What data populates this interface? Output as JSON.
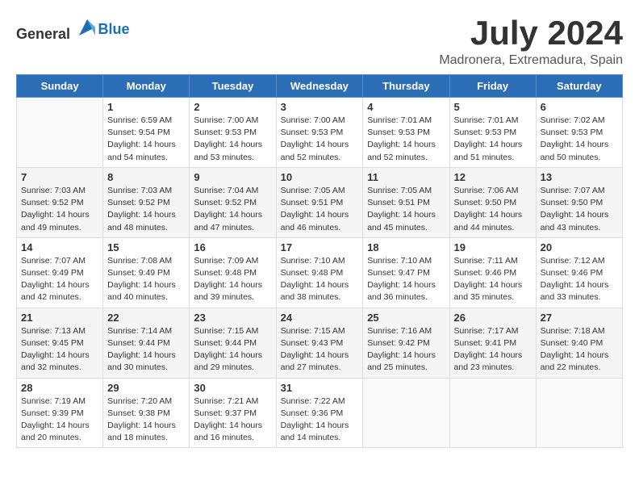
{
  "header": {
    "logo_general": "General",
    "logo_blue": "Blue",
    "month_title": "July 2024",
    "location": "Madronera, Extremadura, Spain"
  },
  "days_of_week": [
    "Sunday",
    "Monday",
    "Tuesday",
    "Wednesday",
    "Thursday",
    "Friday",
    "Saturday"
  ],
  "weeks": [
    [
      {
        "day": "",
        "empty": true
      },
      {
        "day": "1",
        "sunrise": "6:59 AM",
        "sunset": "9:54 PM",
        "daylight": "14 hours and 54 minutes."
      },
      {
        "day": "2",
        "sunrise": "7:00 AM",
        "sunset": "9:53 PM",
        "daylight": "14 hours and 53 minutes."
      },
      {
        "day": "3",
        "sunrise": "7:00 AM",
        "sunset": "9:53 PM",
        "daylight": "14 hours and 52 minutes."
      },
      {
        "day": "4",
        "sunrise": "7:01 AM",
        "sunset": "9:53 PM",
        "daylight": "14 hours and 52 minutes."
      },
      {
        "day": "5",
        "sunrise": "7:01 AM",
        "sunset": "9:53 PM",
        "daylight": "14 hours and 51 minutes."
      },
      {
        "day": "6",
        "sunrise": "7:02 AM",
        "sunset": "9:53 PM",
        "daylight": "14 hours and 50 minutes."
      }
    ],
    [
      {
        "day": "7",
        "sunrise": "7:03 AM",
        "sunset": "9:52 PM",
        "daylight": "14 hours and 49 minutes."
      },
      {
        "day": "8",
        "sunrise": "7:03 AM",
        "sunset": "9:52 PM",
        "daylight": "14 hours and 48 minutes."
      },
      {
        "day": "9",
        "sunrise": "7:04 AM",
        "sunset": "9:52 PM",
        "daylight": "14 hours and 47 minutes."
      },
      {
        "day": "10",
        "sunrise": "7:05 AM",
        "sunset": "9:51 PM",
        "daylight": "14 hours and 46 minutes."
      },
      {
        "day": "11",
        "sunrise": "7:05 AM",
        "sunset": "9:51 PM",
        "daylight": "14 hours and 45 minutes."
      },
      {
        "day": "12",
        "sunrise": "7:06 AM",
        "sunset": "9:50 PM",
        "daylight": "14 hours and 44 minutes."
      },
      {
        "day": "13",
        "sunrise": "7:07 AM",
        "sunset": "9:50 PM",
        "daylight": "14 hours and 43 minutes."
      }
    ],
    [
      {
        "day": "14",
        "sunrise": "7:07 AM",
        "sunset": "9:49 PM",
        "daylight": "14 hours and 42 minutes."
      },
      {
        "day": "15",
        "sunrise": "7:08 AM",
        "sunset": "9:49 PM",
        "daylight": "14 hours and 40 minutes."
      },
      {
        "day": "16",
        "sunrise": "7:09 AM",
        "sunset": "9:48 PM",
        "daylight": "14 hours and 39 minutes."
      },
      {
        "day": "17",
        "sunrise": "7:10 AM",
        "sunset": "9:48 PM",
        "daylight": "14 hours and 38 minutes."
      },
      {
        "day": "18",
        "sunrise": "7:10 AM",
        "sunset": "9:47 PM",
        "daylight": "14 hours and 36 minutes."
      },
      {
        "day": "19",
        "sunrise": "7:11 AM",
        "sunset": "9:46 PM",
        "daylight": "14 hours and 35 minutes."
      },
      {
        "day": "20",
        "sunrise": "7:12 AM",
        "sunset": "9:46 PM",
        "daylight": "14 hours and 33 minutes."
      }
    ],
    [
      {
        "day": "21",
        "sunrise": "7:13 AM",
        "sunset": "9:45 PM",
        "daylight": "14 hours and 32 minutes."
      },
      {
        "day": "22",
        "sunrise": "7:14 AM",
        "sunset": "9:44 PM",
        "daylight": "14 hours and 30 minutes."
      },
      {
        "day": "23",
        "sunrise": "7:15 AM",
        "sunset": "9:44 PM",
        "daylight": "14 hours and 29 minutes."
      },
      {
        "day": "24",
        "sunrise": "7:15 AM",
        "sunset": "9:43 PM",
        "daylight": "14 hours and 27 minutes."
      },
      {
        "day": "25",
        "sunrise": "7:16 AM",
        "sunset": "9:42 PM",
        "daylight": "14 hours and 25 minutes."
      },
      {
        "day": "26",
        "sunrise": "7:17 AM",
        "sunset": "9:41 PM",
        "daylight": "14 hours and 23 minutes."
      },
      {
        "day": "27",
        "sunrise": "7:18 AM",
        "sunset": "9:40 PM",
        "daylight": "14 hours and 22 minutes."
      }
    ],
    [
      {
        "day": "28",
        "sunrise": "7:19 AM",
        "sunset": "9:39 PM",
        "daylight": "14 hours and 20 minutes."
      },
      {
        "day": "29",
        "sunrise": "7:20 AM",
        "sunset": "9:38 PM",
        "daylight": "14 hours and 18 minutes."
      },
      {
        "day": "30",
        "sunrise": "7:21 AM",
        "sunset": "9:37 PM",
        "daylight": "14 hours and 16 minutes."
      },
      {
        "day": "31",
        "sunrise": "7:22 AM",
        "sunset": "9:36 PM",
        "daylight": "14 hours and 14 minutes."
      },
      {
        "day": "",
        "empty": true
      },
      {
        "day": "",
        "empty": true
      },
      {
        "day": "",
        "empty": true
      }
    ]
  ]
}
